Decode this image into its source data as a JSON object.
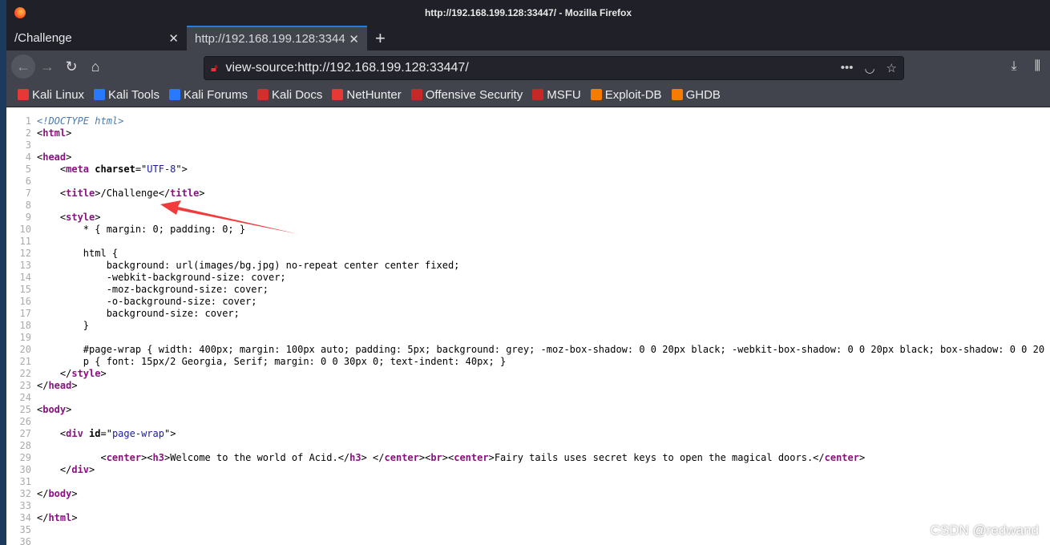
{
  "window": {
    "title": "http://192.168.199.128:33447/ - Mozilla Firefox"
  },
  "tabs": [
    {
      "label": "/Challenge"
    },
    {
      "label": "http://192.168.199.128:3344"
    }
  ],
  "urlbar": {
    "value": "view-source:http://192.168.199.128:33447/"
  },
  "bookmarks": [
    {
      "label": "Kali Linux",
      "color": "#e53935"
    },
    {
      "label": "Kali Tools",
      "color": "#2979ff"
    },
    {
      "label": "Kali Forums",
      "color": "#2979ff"
    },
    {
      "label": "Kali Docs",
      "color": "#d32f2f"
    },
    {
      "label": "NetHunter",
      "color": "#e53935"
    },
    {
      "label": "Offensive Security",
      "color": "#c62828"
    },
    {
      "label": "MSFU",
      "color": "#c62828"
    },
    {
      "label": "Exploit-DB",
      "color": "#f57c00"
    },
    {
      "label": "GHDB",
      "color": "#f57c00"
    }
  ],
  "source_lines": [
    [
      [
        "dt",
        "<!DOCTYPE html>"
      ]
    ],
    [
      [
        "tx",
        "<"
      ],
      [
        "tag",
        "html"
      ],
      [
        "tx",
        ">"
      ]
    ],
    [],
    [
      [
        "tx",
        "<"
      ],
      [
        "tag",
        "head"
      ],
      [
        "tx",
        ">"
      ]
    ],
    [
      [
        "tx",
        "    <"
      ],
      [
        "tag",
        "meta"
      ],
      [
        "at",
        " charset"
      ],
      [
        "tx",
        "=\""
      ],
      [
        "av",
        "UTF-8"
      ],
      [
        "tx",
        "\">"
      ]
    ],
    [],
    [
      [
        "tx",
        "    <"
      ],
      [
        "tag",
        "title"
      ],
      [
        "tx",
        ">/Challenge</"
      ],
      [
        "tag",
        "title"
      ],
      [
        "tx",
        ">"
      ]
    ],
    [],
    [
      [
        "tx",
        "    <"
      ],
      [
        "tag",
        "style"
      ],
      [
        "tx",
        ">"
      ]
    ],
    [
      [
        "tx",
        "        * { margin: 0; padding: 0; }"
      ]
    ],
    [],
    [
      [
        "tx",
        "        html {"
      ]
    ],
    [
      [
        "tx",
        "            background: url(images/bg.jpg) no-repeat center center fixed;"
      ]
    ],
    [
      [
        "tx",
        "            -webkit-background-size: cover;"
      ]
    ],
    [
      [
        "tx",
        "            -moz-background-size: cover;"
      ]
    ],
    [
      [
        "tx",
        "            -o-background-size: cover;"
      ]
    ],
    [
      [
        "tx",
        "            background-size: cover;"
      ]
    ],
    [
      [
        "tx",
        "        }"
      ]
    ],
    [],
    [
      [
        "tx",
        "        #page-wrap { width: 400px; margin: 100px auto; padding: 5px; background: grey; -moz-box-shadow: 0 0 20px black; -webkit-box-shadow: 0 0 20px black; box-shadow: 0 0 20"
      ]
    ],
    [
      [
        "tx",
        "        p { font: 15px/2 Georgia, Serif; margin: 0 0 30px 0; text-indent: 40px; }"
      ]
    ],
    [
      [
        "tx",
        "    </"
      ],
      [
        "tag",
        "style"
      ],
      [
        "tx",
        ">"
      ]
    ],
    [
      [
        "tx",
        "</"
      ],
      [
        "tag",
        "head"
      ],
      [
        "tx",
        ">"
      ]
    ],
    [],
    [
      [
        "tx",
        "<"
      ],
      [
        "tag",
        "body"
      ],
      [
        "tx",
        ">"
      ]
    ],
    [],
    [
      [
        "tx",
        "    <"
      ],
      [
        "tag",
        "div"
      ],
      [
        "at",
        " id"
      ],
      [
        "tx",
        "=\""
      ],
      [
        "av",
        "page-wrap"
      ],
      [
        "tx",
        "\">"
      ]
    ],
    [],
    [
      [
        "tx",
        "           <"
      ],
      [
        "tag",
        "center"
      ],
      [
        "tx",
        "><"
      ],
      [
        "tag",
        "h3"
      ],
      [
        "tx",
        ">Welcome to the world of Acid.</"
      ],
      [
        "tag",
        "h3"
      ],
      [
        "tx",
        "> </"
      ],
      [
        "tag",
        "center"
      ],
      [
        "tx",
        "><"
      ],
      [
        "tag",
        "br"
      ],
      [
        "tx",
        "><"
      ],
      [
        "tag",
        "center"
      ],
      [
        "tx",
        ">Fairy tails uses secret keys to open the magical doors.</"
      ],
      [
        "tag",
        "center"
      ],
      [
        "tx",
        ">"
      ]
    ],
    [
      [
        "tx",
        "    </"
      ],
      [
        "tag",
        "div"
      ],
      [
        "tx",
        ">"
      ]
    ],
    [],
    [
      [
        "tx",
        "</"
      ],
      [
        "tag",
        "body"
      ],
      [
        "tx",
        ">"
      ]
    ],
    [],
    [
      [
        "tx",
        "</"
      ],
      [
        "tag",
        "html"
      ],
      [
        "tx",
        ">"
      ]
    ],
    [],
    []
  ],
  "annotation": {
    "color": "#f03c3c"
  },
  "watermark": "CSDN @redwand"
}
